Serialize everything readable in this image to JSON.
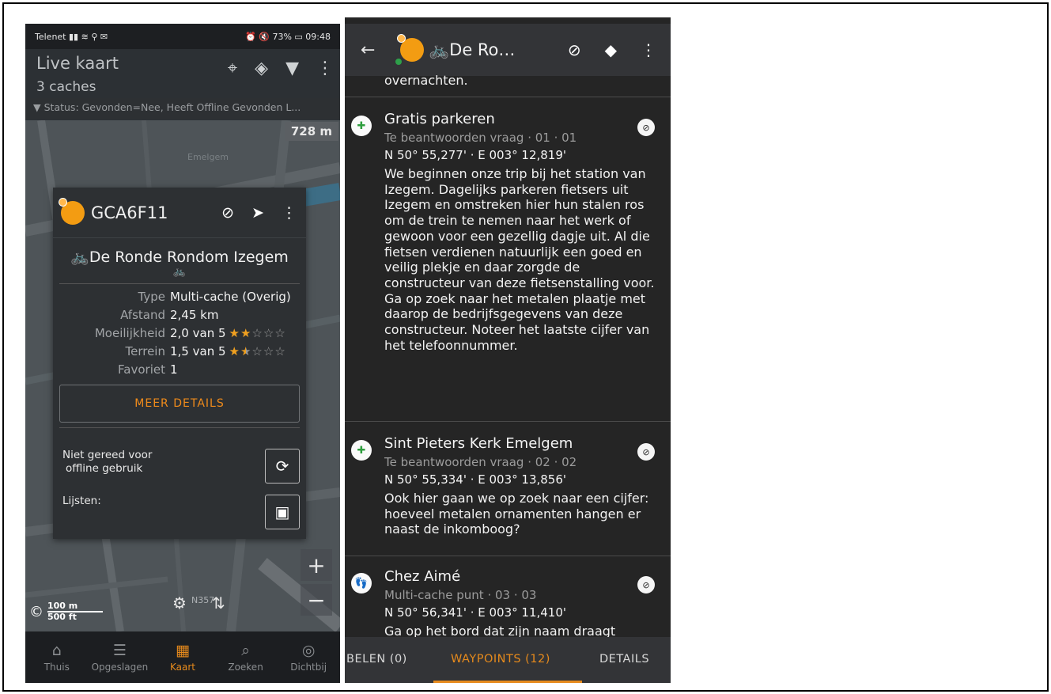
{
  "left": {
    "status": {
      "carrier": "Telenet",
      "signal_icons": "▮▮ ≋ ⚲ ✉",
      "right": "⏰ 🔇 73% ▭ 09:48"
    },
    "appbar": {
      "title": "Live kaart",
      "subtitle": "3 caches"
    },
    "filter": "Status: Gevonden=Nee, Heeft Offline Gevonden L...",
    "distance_chip": "728 m",
    "popup": {
      "code": "GCA6F11",
      "name": "🚲De Ronde Rondom Izegem",
      "sub_icon": "🚲",
      "rows": [
        {
          "k": "Type",
          "v": "Multi-cache (Overig)"
        },
        {
          "k": "Afstand",
          "v": "2,45 km"
        },
        {
          "k": "Moeilijkheid",
          "v": "2,0 van 5",
          "rating": 2.0
        },
        {
          "k": "Terrein",
          "v": "1,5 van 5",
          "rating": 1.5
        },
        {
          "k": "Favoriet",
          "v": "1"
        }
      ],
      "more_details": "MEER DETAILS",
      "offline_line1": "Niet gereed voor",
      "offline_line2": "offline gebruik",
      "lists": "Lijsten:"
    },
    "map_labels": {
      "n357": "N357",
      "scale_m": "100 m",
      "scale_ft": "500 ft",
      "copyright": "©"
    },
    "nav": [
      {
        "label": "Thuis",
        "icon": "⌂"
      },
      {
        "label": "Opgeslagen",
        "icon": "☰"
      },
      {
        "label": "Kaart",
        "icon": "▦"
      },
      {
        "label": "Zoeken",
        "icon": "⌕"
      },
      {
        "label": "Dichtbij",
        "icon": "◎"
      }
    ]
  },
  "right": {
    "appbar": {
      "title": "🚲De Ro…",
      "back": "←"
    },
    "cut_text": "overnachten.",
    "waypoints": [
      {
        "title": "Gratis parkeren",
        "sub": "Te beantwoorden vraag · 01 · 01",
        "coords": "N 50° 55,277' · E 003° 12,819'",
        "desc": "We beginnen onze trip bij het station van Izegem. Dagelijks parkeren fietsers uit Izegem en omstreken hier hun stalen ros om de trein te nemen naar het werk of gewoon voor een gezellig dagje uit. Al die fietsen verdienen natuurlijk een goed en veilig plekje en daar zorgde de constructeur van deze fietsenstalling voor. Ga op zoek naar het metalen plaatje met daarop de bedrijfsgegevens van deze constructeur. Noteer het laatste cijfer van het telefoonnummer.",
        "icon": "✚"
      },
      {
        "title": "Sint Pieters Kerk Emelgem",
        "sub": "Te beantwoorden vraag · 02 · 02",
        "coords": "N 50° 55,334' · E 003° 13,856'",
        "desc": "Ook hier gaan we op zoek naar een cijfer: hoeveel metalen ornamenten hangen er naast de inkomboog?",
        "icon": "✚"
      },
      {
        "title": "Chez Aimé",
        "sub": "Multi-cache punt · 03 · 03",
        "coords": "N 50° 56,341' · E 003° 11,410'",
        "desc": "Ga op het bord dat zijn naam draagt",
        "icon": "👣"
      }
    ],
    "tabs": {
      "left": "BELEN (0)",
      "active": "WAYPOINTS (12)",
      "right": "DETAILS"
    }
  }
}
